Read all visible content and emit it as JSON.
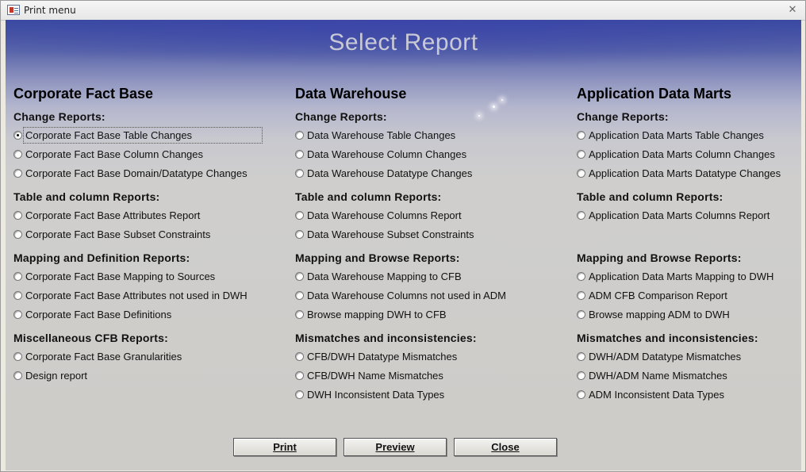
{
  "window": {
    "title": "Print menu"
  },
  "heading": "Select Report",
  "columns": [
    {
      "title": "Corporate Fact Base",
      "sections": [
        {
          "label": "Change Reports:",
          "options": [
            "Corporate Fact Base Table Changes",
            "Corporate Fact Base Column Changes",
            "Corporate Fact Base Domain/Datatype Changes"
          ]
        },
        {
          "label": "Table and column Reports:",
          "options": [
            "Corporate Fact Base Attributes Report",
            "Corporate Fact Base Subset Constraints"
          ]
        },
        {
          "label": "Mapping and Definition Reports:",
          "options": [
            "Corporate Fact Base Mapping to Sources",
            "Corporate Fact Base Attributes not used in DWH",
            "Corporate Fact Base Definitions"
          ]
        },
        {
          "label": "Miscellaneous CFB Reports:",
          "options": [
            "Corporate Fact Base Granularities",
            "Design report"
          ]
        }
      ]
    },
    {
      "title": "Data Warehouse",
      "sections": [
        {
          "label": "Change Reports:",
          "options": [
            "Data Warehouse Table Changes",
            "Data Warehouse Column Changes",
            "Data Warehouse Datatype Changes"
          ]
        },
        {
          "label": "Table and column Reports:",
          "options": [
            "Data Warehouse Columns Report",
            "Data Warehouse Subset Constraints"
          ]
        },
        {
          "label": "Mapping and Browse Reports:",
          "options": [
            "Data Warehouse Mapping to CFB",
            "Data Warehouse Columns not used in ADM",
            "Browse mapping DWH to CFB"
          ]
        },
        {
          "label": "Mismatches and inconsistencies:",
          "options": [
            "CFB/DWH Datatype Mismatches",
            "CFB/DWH Name Mismatches",
            "DWH Inconsistent Data Types"
          ]
        }
      ]
    },
    {
      "title": "Application Data Marts",
      "sections": [
        {
          "label": "Change Reports:",
          "options": [
            "Application Data Marts Table Changes",
            "Application Data Marts Column Changes",
            "Application Data Marts Datatype Changes"
          ]
        },
        {
          "label": "Table and column Reports:",
          "options": [
            "Application Data Marts Columns Report"
          ]
        },
        {
          "label": "Mapping and Browse Reports:",
          "options": [
            "Application Data Marts Mapping to DWH",
            "ADM CFB Comparison Report",
            "Browse mapping ADM to DWH"
          ]
        },
        {
          "label": "Mismatches and inconsistencies:",
          "options": [
            "DWH/ADM Datatype Mismatches",
            "DWH/ADM Name Mismatches",
            "ADM Inconsistent Data Types"
          ]
        }
      ]
    }
  ],
  "selected_option": "Corporate Fact Base Table Changes",
  "buttons": {
    "print": "Print",
    "preview": "Preview",
    "close": "Close"
  },
  "icons": {
    "app": "access-form-icon",
    "close": "close-icon"
  },
  "colors": {
    "heading": "#c8c8d6",
    "header_gradient": "#3a4a9e"
  }
}
